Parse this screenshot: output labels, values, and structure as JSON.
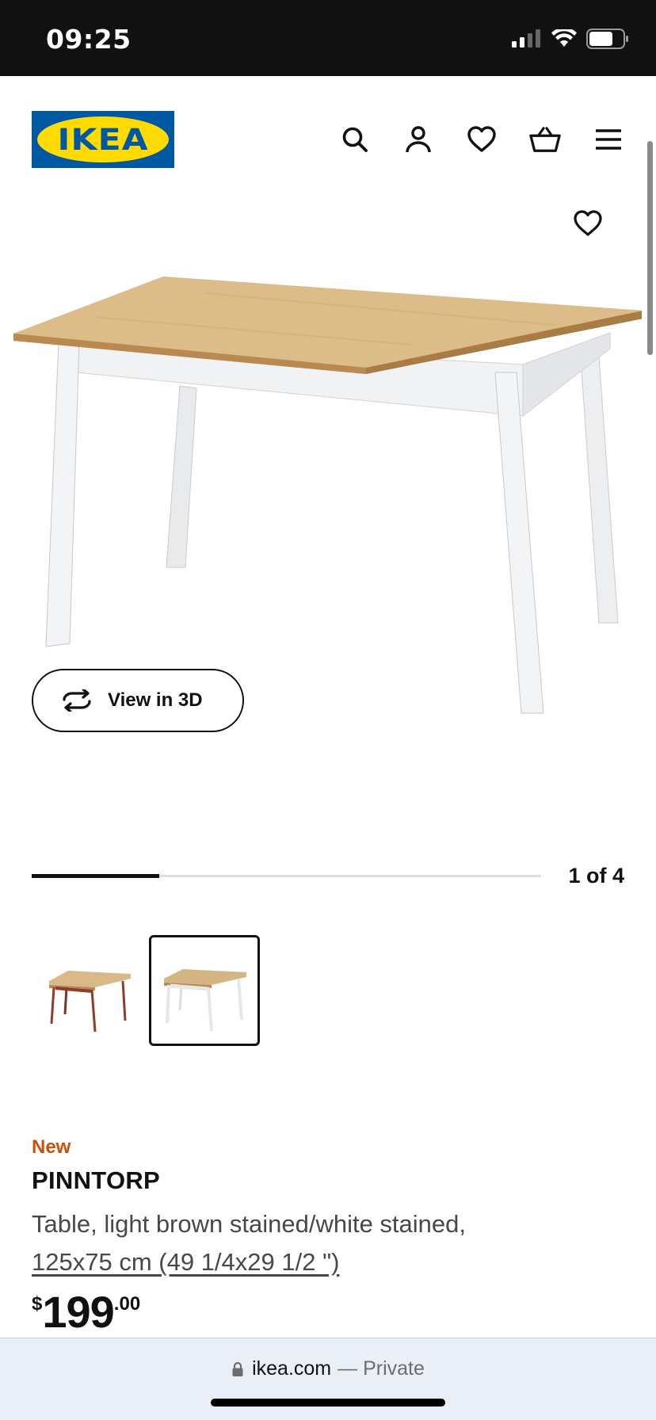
{
  "status_bar": {
    "time": "09:25",
    "icons": [
      "cellular-signal-icon",
      "wifi-icon",
      "battery-icon"
    ]
  },
  "header": {
    "logo_text": "IKEA",
    "icons": [
      "search-icon",
      "account-icon",
      "heart-icon",
      "cart-icon",
      "menu-icon"
    ]
  },
  "gallery": {
    "view3d_label": "View in 3D",
    "counter": "1 of 4",
    "progress_fraction": 0.25,
    "thumbnails": [
      "thumb-brown-table",
      "thumb-white-table"
    ],
    "selected_thumbnail": 2
  },
  "product": {
    "badge": "New",
    "name": "PINNTORP",
    "description": "Table, light brown stained/white stained,",
    "size": "125x75 cm (49 1/4x29 1/2 \")",
    "price_currency": "$",
    "price_int": "199",
    "price_dec": ".00"
  },
  "browser": {
    "domain": "ikea.com",
    "private": "— Private"
  },
  "colors": {
    "ikea_blue": "#0058a3",
    "ikea_yellow": "#ffdb00",
    "new_badge": "#ca5008"
  }
}
